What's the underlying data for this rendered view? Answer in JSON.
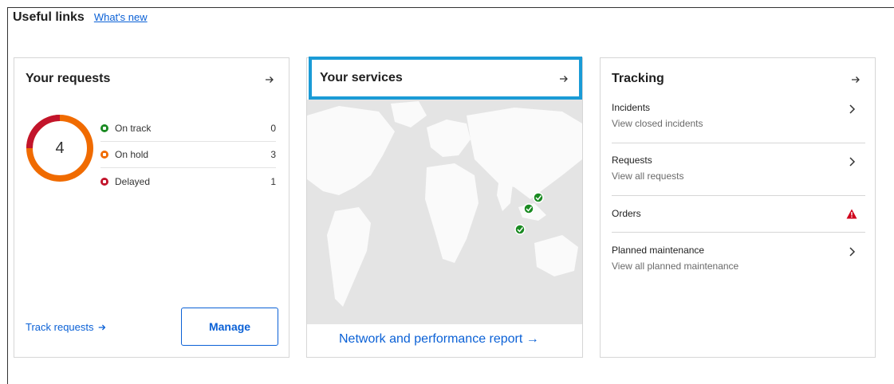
{
  "header": {
    "title": "Useful links",
    "whats_new": "What's new"
  },
  "requests": {
    "title": "Your requests",
    "total": "4",
    "legend": [
      {
        "label": "On track",
        "count": "0",
        "color": "#1a8a22"
      },
      {
        "label": "On hold",
        "count": "3",
        "color": "#f06b00"
      },
      {
        "label": "Delayed",
        "count": "1",
        "color": "#c2142b"
      }
    ],
    "track_link": "Track requests",
    "manage_button": "Manage"
  },
  "services": {
    "title": "Your services",
    "report_link": "Network and performance report →"
  },
  "tracking": {
    "title": "Tracking",
    "items": [
      {
        "title": "Incidents",
        "subtitle": "View closed incidents",
        "icon": "chevron-right-icon"
      },
      {
        "title": "Requests",
        "subtitle": "View all requests",
        "icon": "chevron-right-icon"
      },
      {
        "title": "Orders",
        "subtitle": "",
        "icon": "warning-icon"
      },
      {
        "title": "Planned maintenance",
        "subtitle": "View all planned maintenance",
        "icon": "chevron-right-icon"
      }
    ]
  },
  "colors": {
    "accent": "#0b61d6",
    "highlight": "#1a9bd6",
    "warning": "#d0021b"
  }
}
